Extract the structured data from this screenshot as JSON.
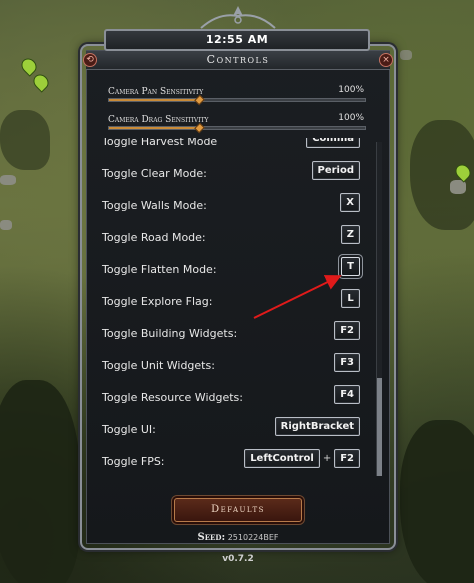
{
  "header": {
    "time": "12:55 AM"
  },
  "panel": {
    "title": "Controls"
  },
  "buttons": {
    "left_symbol": "⟲",
    "close_symbol": "×"
  },
  "sliders": [
    {
      "label": "Camera Pan Sensitivity",
      "value_text": "100%",
      "fraction": 0.35
    },
    {
      "label": "Camera Drag Sensitivity",
      "value_text": "100%",
      "fraction": 0.35
    }
  ],
  "bindings": [
    {
      "label": "Toggle Harvest Mode",
      "keys": [
        "Comma"
      ]
    },
    {
      "label": "Toggle Clear Mode:",
      "keys": [
        "Period"
      ]
    },
    {
      "label": "Toggle Walls Mode:",
      "keys": [
        "X"
      ]
    },
    {
      "label": "Toggle Road Mode:",
      "keys": [
        "Z"
      ]
    },
    {
      "label": "Toggle Flatten Mode:",
      "keys": [
        "T"
      ]
    },
    {
      "label": "Toggle Explore Flag:",
      "keys": [
        "L"
      ]
    },
    {
      "label": "Toggle Building Widgets:",
      "keys": [
        "F2"
      ]
    },
    {
      "label": "Toggle Unit Widgets:",
      "keys": [
        "F3"
      ]
    },
    {
      "label": "Toggle Resource Widgets:",
      "keys": [
        "F4"
      ]
    },
    {
      "label": "Toggle UI:",
      "keys": [
        "RightBracket"
      ]
    },
    {
      "label": "Toggle FPS:",
      "keys": [
        "LeftControl",
        "F2"
      ],
      "separator": "+"
    }
  ],
  "highlighted_binding_index": 4,
  "scroll_fraction": 0.7,
  "footer": {
    "defaults_label": "Defaults",
    "seed_label": "Seed:",
    "seed_value": "2510224BEF",
    "version": "v0.7.2"
  },
  "colors": {
    "accent": "#c98b38",
    "annotation_arrow": "#e01a1a",
    "close": "#c27060"
  }
}
